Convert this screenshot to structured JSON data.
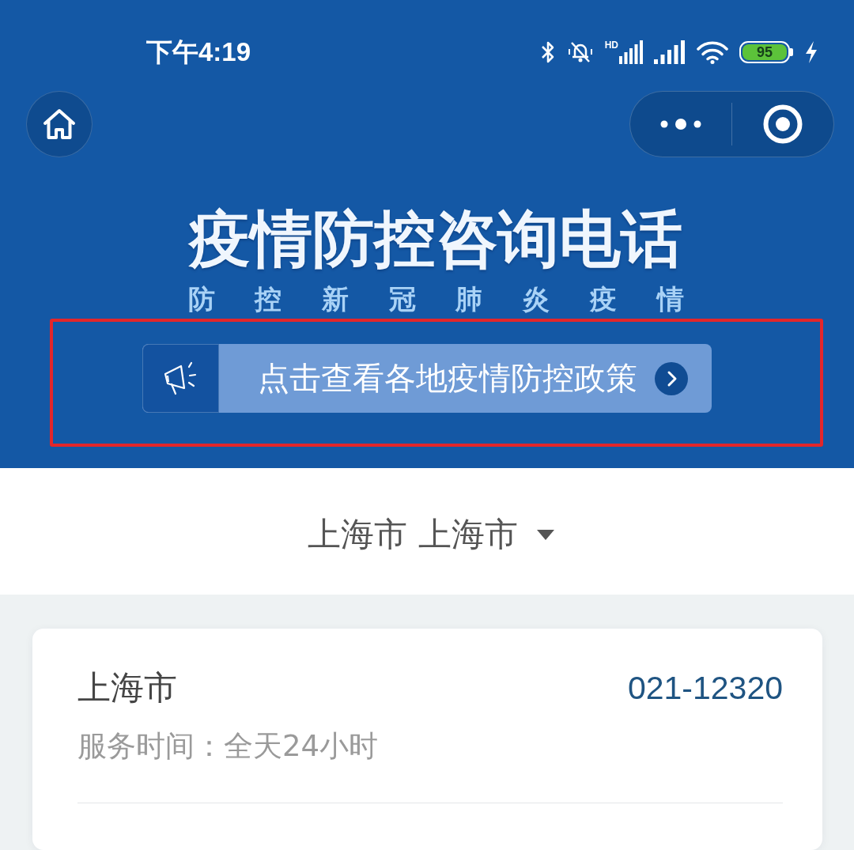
{
  "status_bar": {
    "time": "下午4:19",
    "network_tag": "HD",
    "battery_percent": "95",
    "charging": true
  },
  "header": {
    "title": "疫情防控咨询电话",
    "subtitle": "防控新冠肺炎疫情"
  },
  "policy_banner": {
    "text": "点击查看各地疫情防控政策",
    "highlighted": true
  },
  "region_picker": {
    "value": "上海市 上海市"
  },
  "hotlines": [
    {
      "name": "上海市",
      "phone": "021-12320",
      "hours": "服务时间：全天24小时"
    }
  ]
}
